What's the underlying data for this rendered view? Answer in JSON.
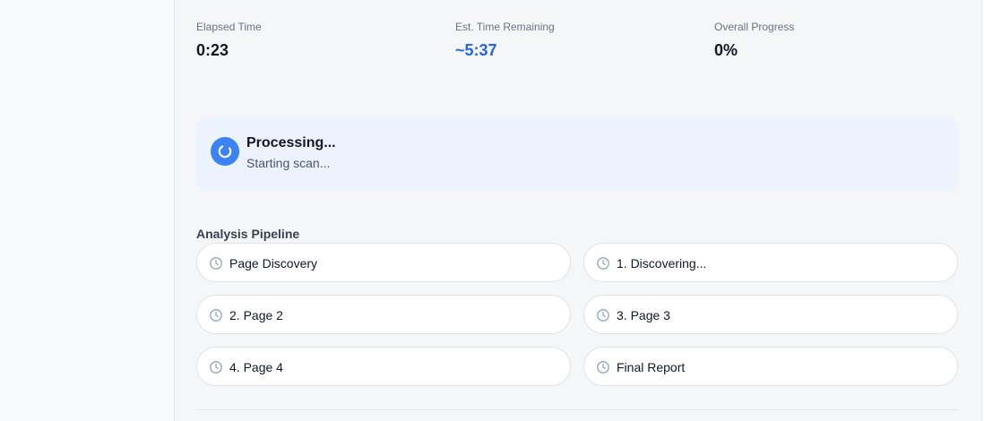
{
  "stats": {
    "elapsed": {
      "label": "Elapsed Time",
      "value": "0:23"
    },
    "remaining": {
      "label": "Est. Time Remaining",
      "value": "~5:37"
    },
    "progress": {
      "label": "Overall Progress",
      "value": "0%"
    }
  },
  "status": {
    "title": "Processing...",
    "subtitle": "Starting scan...",
    "icon": "spinner-icon"
  },
  "pipeline": {
    "title": "Analysis Pipeline",
    "steps": [
      {
        "label": "Page Discovery",
        "icon": "clock-icon"
      },
      {
        "label": "1. Discovering...",
        "icon": "clock-icon"
      },
      {
        "label": "2. Page 2",
        "icon": "clock-icon"
      },
      {
        "label": "3. Page 3",
        "icon": "clock-icon"
      },
      {
        "label": "4. Page 4",
        "icon": "clock-icon"
      },
      {
        "label": "Final Report",
        "icon": "clock-icon"
      }
    ]
  },
  "colors": {
    "accent": "#2563eb",
    "spinner": "#3b82f6",
    "status_background": "#edf3fd"
  }
}
